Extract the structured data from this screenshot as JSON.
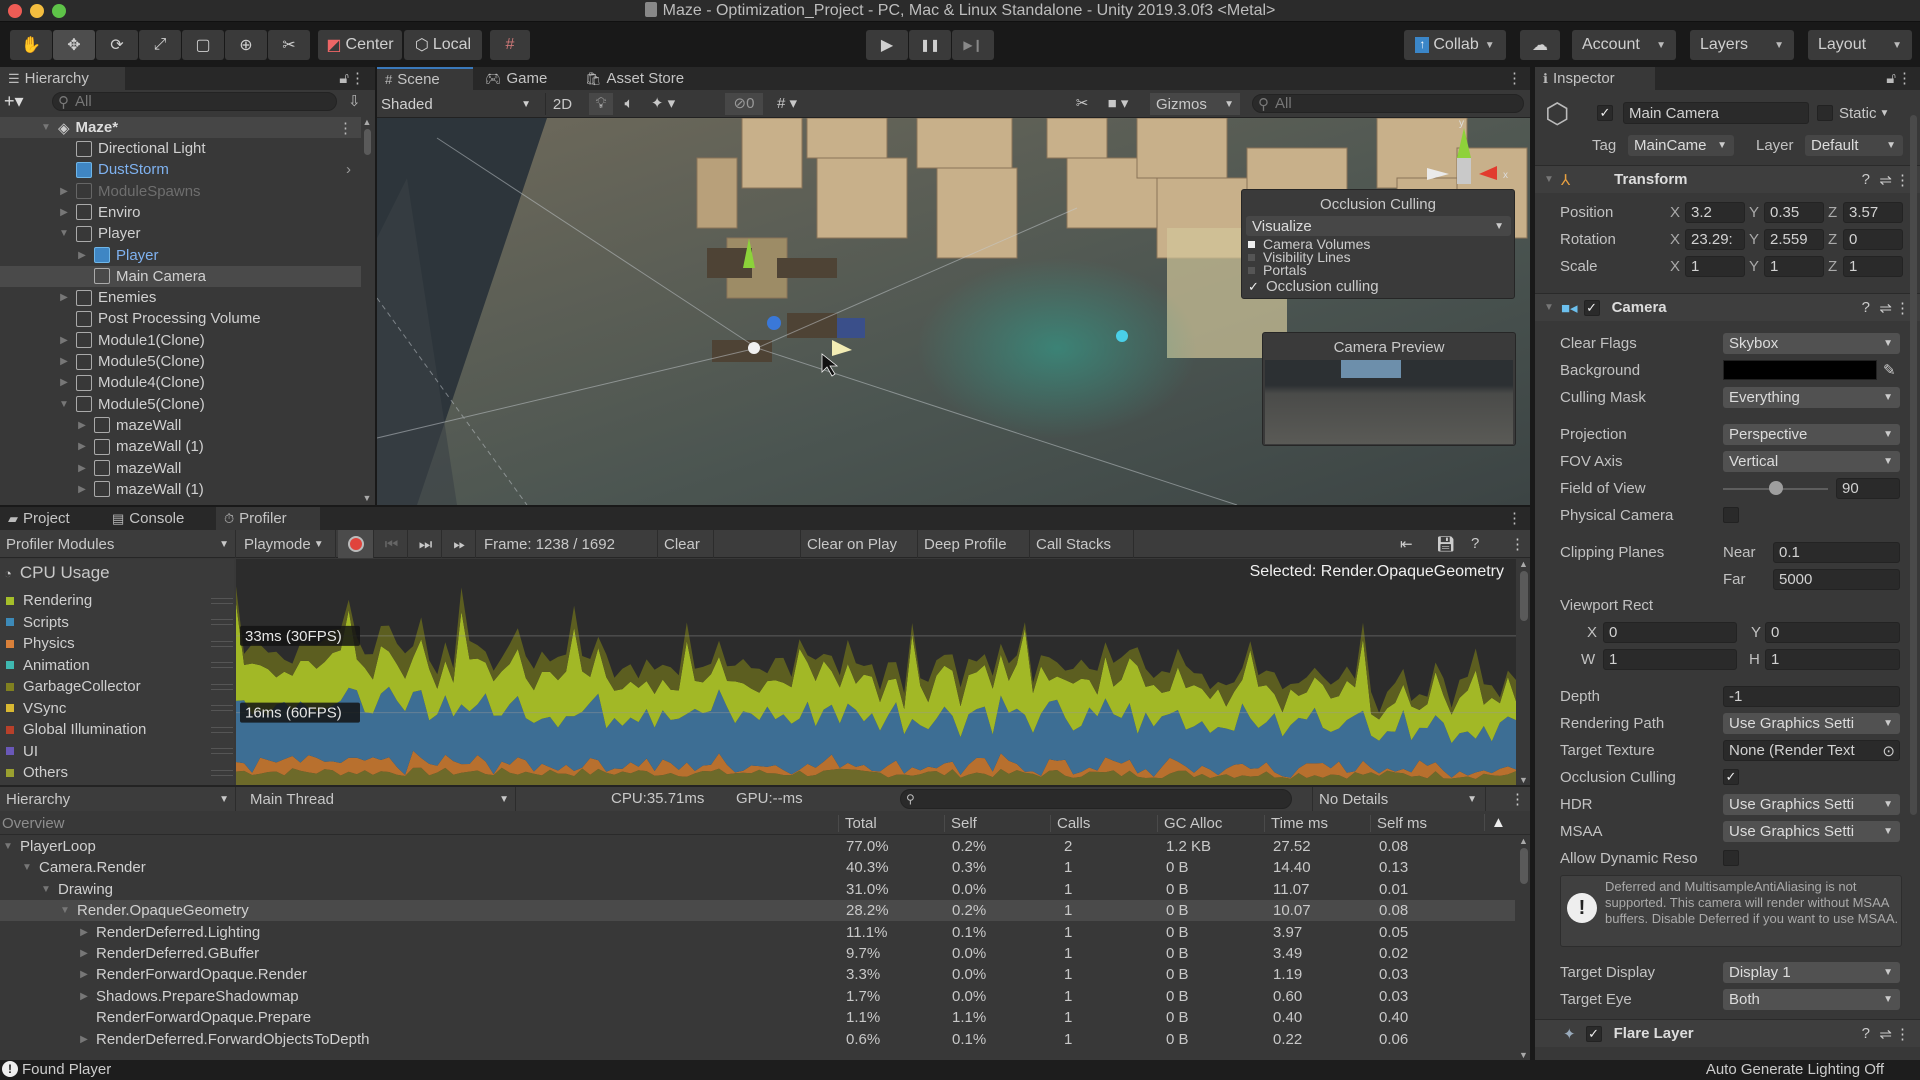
{
  "window": {
    "title": "Maze - Optimization_Project - PC, Mac & Linux Standalone - Unity 2019.3.0f3 <Metal>"
  },
  "toolbar": {
    "tools": [
      {
        "name": "hand-tool",
        "glyph": "✋"
      },
      {
        "name": "move-tool",
        "glyph": "✥"
      },
      {
        "name": "rotate-tool",
        "glyph": "⟳"
      },
      {
        "name": "scale-tool",
        "glyph": "⤢"
      },
      {
        "name": "rect-tool",
        "glyph": "▢"
      },
      {
        "name": "transform-tool",
        "glyph": "⊕"
      },
      {
        "name": "custom-tool",
        "glyph": "✂"
      }
    ],
    "pivot_label": "Center",
    "space_label": "Local",
    "play_glyph": "▶",
    "pause_glyph": "❚❚",
    "step_glyph": "▶❙",
    "collab_label": "Collab",
    "account_label": "Account",
    "layers_label": "Layers",
    "layout_label": "Layout"
  },
  "hierarchy": {
    "tab_label": "Hierarchy",
    "search_placeholder": "All",
    "scene_name": "Maze*",
    "items": [
      {
        "label": "Directional Light",
        "depth": 1,
        "expander": "none",
        "style": "normal"
      },
      {
        "label": "DustStorm",
        "depth": 1,
        "expander": "none",
        "style": "prefab"
      },
      {
        "label": "ModuleSpawns",
        "depth": 1,
        "expander": "collapsed",
        "style": "disabled"
      },
      {
        "label": "Enviro",
        "depth": 1,
        "expander": "collapsed",
        "style": "normal"
      },
      {
        "label": "Player",
        "depth": 1,
        "expander": "expanded",
        "style": "normal"
      },
      {
        "label": "Player",
        "depth": 2,
        "expander": "collapsed",
        "style": "prefab"
      },
      {
        "label": "Main Camera",
        "depth": 2,
        "expander": "none",
        "style": "selected"
      },
      {
        "label": "Enemies",
        "depth": 1,
        "expander": "collapsed",
        "style": "normal"
      },
      {
        "label": "Post Processing Volume",
        "depth": 1,
        "expander": "none",
        "style": "normal"
      },
      {
        "label": "Module1(Clone)",
        "depth": 1,
        "expander": "collapsed",
        "style": "normal"
      },
      {
        "label": "Module5(Clone)",
        "depth": 1,
        "expander": "collapsed",
        "style": "normal"
      },
      {
        "label": "Module4(Clone)",
        "depth": 1,
        "expander": "collapsed",
        "style": "normal"
      },
      {
        "label": "Module5(Clone)",
        "depth": 1,
        "expander": "expanded",
        "style": "normal"
      },
      {
        "label": "mazeWall",
        "depth": 2,
        "expander": "collapsed",
        "style": "normal"
      },
      {
        "label": "mazeWall (1)",
        "depth": 2,
        "expander": "collapsed",
        "style": "normal"
      },
      {
        "label": "mazeWall",
        "depth": 2,
        "expander": "collapsed",
        "style": "normal"
      },
      {
        "label": "mazeWall (1)",
        "depth": 2,
        "expander": "collapsed",
        "style": "normal"
      }
    ]
  },
  "scene": {
    "tabs": [
      "Scene",
      "Game",
      "Asset Store"
    ],
    "draw_mode": "Shaded",
    "mode_2d": "2D",
    "hidden_count": "0",
    "gizmos_label": "Gizmos",
    "search_placeholder": "All",
    "occlusion_overlay": {
      "title": "Occlusion Culling",
      "mode": "Visualize",
      "options": [
        {
          "label": "Camera Volumes",
          "checked": true
        },
        {
          "label": "Visibility Lines",
          "checked": false
        },
        {
          "label": "Portals",
          "checked": false
        }
      ],
      "occlusion_culling_label": "Occlusion culling",
      "occlusion_culling_checked": true
    },
    "camera_preview_title": "Camera Preview"
  },
  "inspector": {
    "tab_label": "Inspector",
    "object_name": "Main Camera",
    "active": true,
    "static_label": "Static",
    "tag_label": "Tag",
    "tag_value": "MainCame",
    "layer_label": "Layer",
    "layer_value": "Default",
    "transform": {
      "title": "Transform",
      "position": {
        "label": "Position",
        "x": "3.2",
        "y": "0.35",
        "z": "3.57"
      },
      "rotation": {
        "label": "Rotation",
        "x": "23.29:",
        "y": "2.559",
        "z": "0"
      },
      "scale": {
        "label": "Scale",
        "x": "1",
        "y": "1",
        "z": "1"
      }
    },
    "camera": {
      "title": "Camera",
      "enabled": true,
      "clear_flags": {
        "label": "Clear Flags",
        "value": "Skybox"
      },
      "background": {
        "label": "Background",
        "color": "#000000"
      },
      "culling_mask": {
        "label": "Culling Mask",
        "value": "Everything"
      },
      "projection": {
        "label": "Projection",
        "value": "Perspective"
      },
      "fov_axis": {
        "label": "FOV Axis",
        "value": "Vertical"
      },
      "field_of_view": {
        "label": "Field of View",
        "value": "90",
        "slider_fraction": 0.5
      },
      "physical_camera": {
        "label": "Physical Camera",
        "checked": false
      },
      "clipping_planes": {
        "label": "Clipping Planes",
        "near_label": "Near",
        "near": "0.1",
        "far_label": "Far",
        "far": "5000"
      },
      "viewport_rect": {
        "label": "Viewport Rect",
        "x": "0",
        "y": "0",
        "w": "1",
        "h": "1"
      },
      "depth": {
        "label": "Depth",
        "value": "-1"
      },
      "rendering_path": {
        "label": "Rendering Path",
        "value": "Use Graphics Setti"
      },
      "target_texture": {
        "label": "Target Texture",
        "value": "None (Render Text"
      },
      "occlusion_culling": {
        "label": "Occlusion Culling",
        "checked": true
      },
      "hdr": {
        "label": "HDR",
        "value": "Use Graphics Setti"
      },
      "msaa": {
        "label": "MSAA",
        "value": "Use Graphics Setti"
      },
      "allow_dynamic_reso": {
        "label": "Allow Dynamic Reso",
        "checked": false
      },
      "warning": "Deferred and MultisampleAntiAliasing is not supported. This camera will render without MSAA buffers. Disable Deferred if you want to use MSAA.",
      "target_display": {
        "label": "Target Display",
        "value": "Display 1"
      },
      "target_eye": {
        "label": "Target Eye",
        "value": "Both"
      }
    },
    "flare_layer": {
      "title": "Flare Layer",
      "enabled": true
    }
  },
  "bottom_tabs": [
    "Project",
    "Console",
    "Profiler"
  ],
  "profiler": {
    "modules_label": "Profiler Modules",
    "target_label": "Playmode",
    "frame_label": "Frame: 1238 / 1692",
    "clear_label": "Clear",
    "clear_on_play_label": "Clear on Play",
    "deep_profile_label": "Deep Profile",
    "call_stacks_label": "Call Stacks",
    "selected_label": "Selected: Render.OpaqueGeometry",
    "cpu_usage_label": "CPU Usage",
    "legend": [
      {
        "label": "Rendering",
        "color": "#a5bf2a"
      },
      {
        "label": "Scripts",
        "color": "#3d8ab8"
      },
      {
        "label": "Physics",
        "color": "#d9803a"
      },
      {
        "label": "Animation",
        "color": "#3fb8b0"
      },
      {
        "label": "GarbageCollector",
        "color": "#808020"
      },
      {
        "label": "VSync",
        "color": "#d8b832"
      },
      {
        "label": "Global Illumination",
        "color": "#b8402a"
      },
      {
        "label": "UI",
        "color": "#6a58b8"
      },
      {
        "label": "Others",
        "color": "#9aa030"
      }
    ],
    "view_label": "Hierarchy",
    "thread_label": "Main Thread",
    "cpu_time": "CPU:35.71ms",
    "gpu_time": "GPU:--ms",
    "details_label": "No Details",
    "columns": [
      "Overview",
      "Total",
      "Self",
      "Calls",
      "GC Alloc",
      "Time ms",
      "Self ms"
    ],
    "rows": [
      {
        "name": "PlayerLoop",
        "depth": 0,
        "expander": "expanded",
        "total": "77.0%",
        "self": "0.2%",
        "calls": "2",
        "gc": "1.2 KB",
        "time": "27.52",
        "self_ms": "0.08"
      },
      {
        "name": "Camera.Render",
        "depth": 1,
        "expander": "expanded",
        "total": "40.3%",
        "self": "0.3%",
        "calls": "1",
        "gc": "0 B",
        "time": "14.40",
        "self_ms": "0.13"
      },
      {
        "name": "Drawing",
        "depth": 2,
        "expander": "expanded",
        "total": "31.0%",
        "self": "0.0%",
        "calls": "1",
        "gc": "0 B",
        "time": "11.07",
        "self_ms": "0.01"
      },
      {
        "name": "Render.OpaqueGeometry",
        "depth": 3,
        "expander": "expanded",
        "selected": true,
        "total": "28.2%",
        "self": "0.2%",
        "calls": "1",
        "gc": "0 B",
        "time": "10.07",
        "self_ms": "0.08"
      },
      {
        "name": "RenderDeferred.Lighting",
        "depth": 4,
        "expander": "collapsed",
        "total": "11.1%",
        "self": "0.1%",
        "calls": "1",
        "gc": "0 B",
        "time": "3.97",
        "self_ms": "0.05"
      },
      {
        "name": "RenderDeferred.GBuffer",
        "depth": 4,
        "expander": "collapsed",
        "total": "9.7%",
        "self": "0.0%",
        "calls": "1",
        "gc": "0 B",
        "time": "3.49",
        "self_ms": "0.02"
      },
      {
        "name": "RenderForwardOpaque.Render",
        "depth": 4,
        "expander": "collapsed",
        "total": "3.3%",
        "self": "0.0%",
        "calls": "1",
        "gc": "0 B",
        "time": "1.19",
        "self_ms": "0.03"
      },
      {
        "name": "Shadows.PrepareShadowmap",
        "depth": 4,
        "expander": "collapsed",
        "total": "1.7%",
        "self": "0.0%",
        "calls": "1",
        "gc": "0 B",
        "time": "0.60",
        "self_ms": "0.03"
      },
      {
        "name": "RenderForwardOpaque.Prepare",
        "depth": 4,
        "expander": "none",
        "total": "1.1%",
        "self": "1.1%",
        "calls": "1",
        "gc": "0 B",
        "time": "0.40",
        "self_ms": "0.40"
      },
      {
        "name": "RenderDeferred.ForwardObjectsToDepth",
        "depth": 4,
        "expander": "collapsed",
        "total": "0.6%",
        "self": "0.1%",
        "calls": "1",
        "gc": "0 B",
        "time": "0.22",
        "self_ms": "0.06"
      }
    ]
  },
  "chart_data": {
    "type": "area",
    "title": "CPU Usage",
    "ylabel": "ms",
    "ylim": [
      0,
      50
    ],
    "reference_lines": [
      {
        "value": 33,
        "label": "33ms (30FPS)"
      },
      {
        "value": 16,
        "label": "16ms (60FPS)"
      }
    ],
    "stacked": true,
    "series": [
      {
        "name": "Others",
        "color": "#6d6a2a",
        "base": 3,
        "amp": 1
      },
      {
        "name": "Physics",
        "color": "#b8702e",
        "base": 2,
        "amp": 2
      },
      {
        "name": "Scripts",
        "color": "#3d6e94",
        "base": 13,
        "amp": 3
      },
      {
        "name": "Rendering",
        "color": "#a2b826",
        "base": 9,
        "amp": 3
      },
      {
        "name": "GarbageCollector",
        "color": "#5c5e20",
        "base": 4,
        "amp": 2
      }
    ],
    "frames": 160,
    "trend": "decreasing from ~38ms to ~30ms with periodic spikes up to ~45ms"
  },
  "status": {
    "message": "Found Player",
    "lighting": "Auto Generate Lighting Off"
  }
}
